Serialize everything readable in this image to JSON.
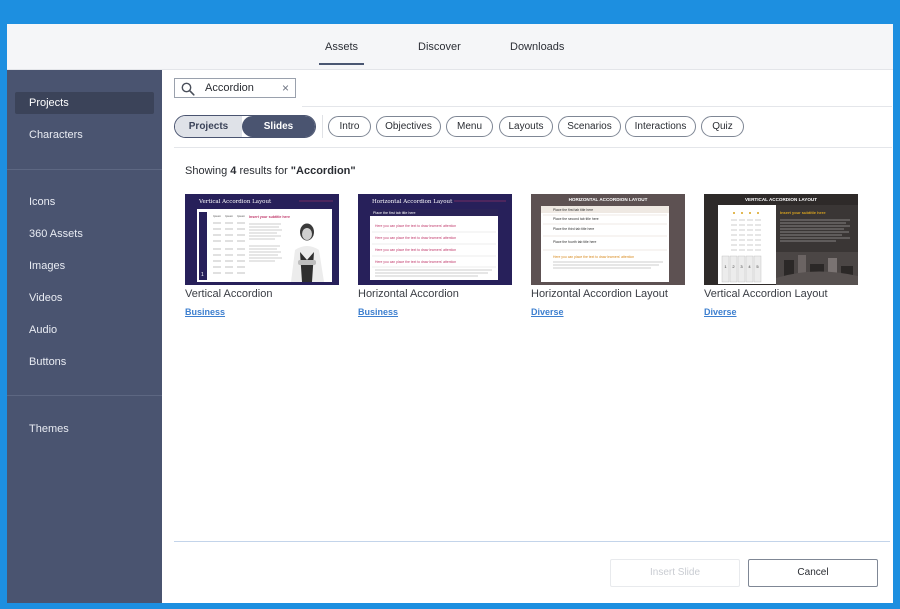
{
  "tabs": [
    {
      "label": "Assets",
      "active": true
    },
    {
      "label": "Discover",
      "active": false
    },
    {
      "label": "Downloads",
      "active": false
    }
  ],
  "sidebar": {
    "items": [
      {
        "label": "Projects",
        "active": true
      },
      {
        "label": "Characters"
      },
      {
        "label": "Icons"
      },
      {
        "label": "360 Assets"
      },
      {
        "label": "Images"
      },
      {
        "label": "Videos"
      },
      {
        "label": "Audio"
      },
      {
        "label": "Buttons"
      },
      {
        "label": "Themes"
      }
    ]
  },
  "search": {
    "value": "Accordion",
    "clear": "×",
    "icon": "search-icon"
  },
  "toggle": {
    "left": "Projects",
    "right": "Slides",
    "selected": "Slides"
  },
  "filters": [
    "Intro",
    "Objectives",
    "Menu",
    "Layouts",
    "Scenarios",
    "Interactions",
    "Quiz"
  ],
  "results": {
    "prefix": "Showing ",
    "count": "4",
    "middle": " results for ",
    "query": "\"Accordion\""
  },
  "cards": [
    {
      "title": "Vertical Accordion",
      "tag": "Business",
      "thumb": {
        "heading": "Vertical Accordion Layout",
        "subtitle": "Insert your subtitle here",
        "row_labels": [
          "Ipsum",
          "Ipsum",
          "Ipsum"
        ],
        "number": "1"
      }
    },
    {
      "title": "Horizontal Accordion",
      "tag": "Business",
      "thumb": {
        "heading": "Horizontal Accordion Layout",
        "first_tab": "Place the first tab title here",
        "lines": [
          "Here you can place the text to draw learners' attention",
          "Here you can place the text to draw learners' attention",
          "Here you can place the text to draw learners' attention",
          "Here you can place the text to draw learners' attention"
        ]
      }
    },
    {
      "title": "Horizontal Accordion Layout",
      "tag": "Diverse",
      "thumb": {
        "heading": "HORIZONTAL ACCORDION LAYOUT",
        "tabs": [
          "Place the first tab title here",
          "Place the second tab title here",
          "Place the third tab title here",
          "Place the fourth tab title here"
        ],
        "highlight": "Here you can place the text to draw learners' attention"
      }
    },
    {
      "title": "Vertical Accordion Layout",
      "tag": "Diverse",
      "thumb": {
        "heading": "VERTICAL ACCORDION LAYOUT",
        "subtitle": "Insert your subtitle here",
        "numbers": [
          "1",
          "2",
          "3",
          "4",
          "5"
        ]
      }
    }
  ],
  "buttons": {
    "insert": "Insert Slide",
    "cancel": "Cancel"
  },
  "colors": {
    "background": "#1d8fe0",
    "sidebar": "#4a5470",
    "accent": "#3d7fcf",
    "thumb_navy": "#27205a"
  }
}
